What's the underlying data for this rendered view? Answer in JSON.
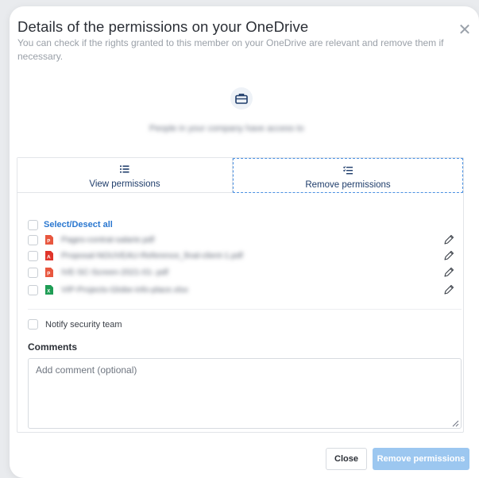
{
  "dialog": {
    "title": "Details of the permissions on your OneDrive",
    "subtitle": "You can check if the rights granted to this member on your OneDrive are relevant and remove them if necessary.",
    "header_icon": "briefcase-icon",
    "caption": "People in your company have access to",
    "close_icon": "close-icon"
  },
  "tabs": [
    {
      "label": "View permissions",
      "icon": "list-icon"
    },
    {
      "label": "Remove permissions",
      "icon": "checklist-icon",
      "active": true
    }
  ],
  "select_all_label": "Select/Desect all",
  "files": [
    {
      "name": "Pages-contrat-salarie.pdf",
      "type": "pdf",
      "icon": "pdf-file-icon",
      "color": "#e8573f"
    },
    {
      "name": "Proposal-NOUVEAU-Reference_final-client-1.pdf",
      "type": "acrobat",
      "icon": "acrobat-file-icon",
      "color": "#e0342a"
    },
    {
      "name": "IVE-SC-Screen-2021-01-.pdf",
      "type": "pdf",
      "icon": "pdf-file-icon",
      "color": "#e8573f"
    },
    {
      "name": "VIP-Projects-Globe-info-place.xlsx",
      "type": "excel",
      "icon": "excel-file-icon",
      "color": "#1f9d55"
    }
  ],
  "notify_label": "Notify security team",
  "comments": {
    "title": "Comments",
    "placeholder": "Add comment (optional)",
    "value": ""
  },
  "buttons": {
    "close": "Close",
    "remove": "Remove permissions"
  },
  "colors": {
    "accent": "#2b78d0",
    "primary_disabled": "#9cc7f0",
    "tab_border": "#4a90e2"
  }
}
